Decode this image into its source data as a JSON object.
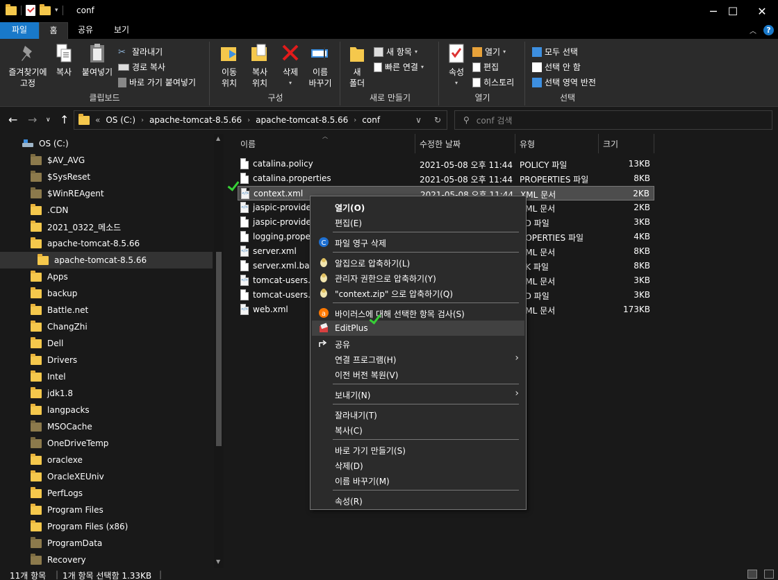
{
  "window": {
    "title": "conf",
    "minimize": "─",
    "maximize": "☐",
    "close": "✕"
  },
  "ribbon_tabs": [
    "파일",
    "홈",
    "공유",
    "보기"
  ],
  "ribbon": {
    "clipboard": {
      "pin": "즐겨찾기에\n고정",
      "copy": "복사",
      "paste": "붙여넣기",
      "cut": "잘라내기",
      "copy_path": "경로 복사",
      "paste_shortcut": "바로 가기 붙여넣기",
      "label": "클립보드"
    },
    "organize": {
      "move": "이동\n위치",
      "copyto": "복사\n위치",
      "delete": "삭제",
      "rename": "이름\n바꾸기",
      "label": "구성"
    },
    "new": {
      "new_folder": "새\n폴더",
      "new_item": "새 항목",
      "easy_access": "빠른 연결",
      "label": "새로 만들기"
    },
    "open": {
      "properties": "속성",
      "open": "열기",
      "edit": "편집",
      "history": "히스토리",
      "label": "열기"
    },
    "select": {
      "select_all": "모두 선택",
      "select_none": "선택 안 함",
      "invert": "선택 영역 반전",
      "label": "선택"
    }
  },
  "address": {
    "overflow": "«",
    "crumbs": [
      "OS (C:)",
      "apache-tomcat-8.5.66",
      "apache-tomcat-8.5.66",
      "conf"
    ],
    "search_placeholder": "conf 검색"
  },
  "nav": {
    "drive": "OS (C:)",
    "items": [
      {
        "name": "$AV_AVG",
        "gray": true
      },
      {
        "name": "$SysReset",
        "gray": true
      },
      {
        "name": "$WinREAgent",
        "gray": true
      },
      {
        "name": ".CDN",
        "gray": false
      },
      {
        "name": "2021_0322_메소드",
        "gray": false
      },
      {
        "name": "apache-tomcat-8.5.66",
        "gray": false
      },
      {
        "name": "apache-tomcat-8.5.66",
        "gray": false,
        "selected": true,
        "indent": true
      },
      {
        "name": "Apps",
        "gray": false
      },
      {
        "name": "backup",
        "gray": false
      },
      {
        "name": "Battle.net",
        "gray": false
      },
      {
        "name": "ChangZhi",
        "gray": false
      },
      {
        "name": "Dell",
        "gray": false
      },
      {
        "name": "Drivers",
        "gray": false
      },
      {
        "name": "Intel",
        "gray": false
      },
      {
        "name": "jdk1.8",
        "gray": false
      },
      {
        "name": "langpacks",
        "gray": false
      },
      {
        "name": "MSOCache",
        "gray": true
      },
      {
        "name": "OneDriveTemp",
        "gray": true
      },
      {
        "name": "oraclexe",
        "gray": false
      },
      {
        "name": "OracleXEUniv",
        "gray": false
      },
      {
        "name": "PerfLogs",
        "gray": false
      },
      {
        "name": "Program Files",
        "gray": false
      },
      {
        "name": "Program Files (x86)",
        "gray": false
      },
      {
        "name": "ProgramData",
        "gray": true
      },
      {
        "name": "Recovery",
        "gray": true
      }
    ]
  },
  "columns": {
    "name": "이름",
    "modified": "수정한 날짜",
    "type": "유형",
    "size": "크기"
  },
  "files": [
    {
      "name": "catalina.policy",
      "date": "2021-05-08 오후 11:44",
      "type": "POLICY 파일",
      "size": "13KB",
      "xml": false
    },
    {
      "name": "catalina.properties",
      "date": "2021-05-08 오후 11:44",
      "type": "PROPERTIES 파일",
      "size": "8KB",
      "xml": false
    },
    {
      "name": "context.xml",
      "date": "2021-05-08 오후 11:44",
      "type": "XML 문서",
      "size": "2KB",
      "xml": true,
      "selected": true
    },
    {
      "name": "jaspic-providers",
      "date": "",
      "type": "XML 문서",
      "size": "2KB",
      "xml": true
    },
    {
      "name": "jaspic-providers",
      "date": "",
      "type": "SD 파일",
      "size": "3KB",
      "xml": false
    },
    {
      "name": "logging.propert",
      "date": "",
      "type": "ROPERTIES 파일",
      "size": "4KB",
      "xml": false
    },
    {
      "name": "server.xml",
      "date": "",
      "type": "XML 문서",
      "size": "8KB",
      "xml": true
    },
    {
      "name": "server.xml.bak",
      "date": "",
      "type": "AK 파일",
      "size": "8KB",
      "xml": false
    },
    {
      "name": "tomcat-users.xr",
      "date": "",
      "type": "XML 문서",
      "size": "3KB",
      "xml": true
    },
    {
      "name": "tomcat-users.xs",
      "date": "",
      "type": "SD 파일",
      "size": "3KB",
      "xml": false
    },
    {
      "name": "web.xml",
      "date": "",
      "type": "XML 문서",
      "size": "173KB",
      "xml": true
    }
  ],
  "context_menu": [
    {
      "label": "열기(O)",
      "bold": true
    },
    {
      "label": "편집(E)"
    },
    {
      "sep": true
    },
    {
      "label": "파일 영구 삭제",
      "icon": "ccleaner-icon"
    },
    {
      "sep": true
    },
    {
      "label": "알집으로 압축하기(L)",
      "icon": "alzip-icon"
    },
    {
      "label": "관리자 권한으로 압축하기(Y)",
      "icon": "alzip-icon"
    },
    {
      "label": "\"context.zip\" 으로 압축하기(Q)",
      "icon": "alzip-icon"
    },
    {
      "sep": true
    },
    {
      "label": "바이러스에 대해 선택한 항목 검사(S)",
      "icon": "avast-icon"
    },
    {
      "label": "EditPlus",
      "icon": "editplus-icon",
      "highlight": true
    },
    {
      "label": "공유",
      "icon": "share-icon"
    },
    {
      "label": "연결 프로그램(H)",
      "submenu": true
    },
    {
      "label": "이전 버전 복원(V)"
    },
    {
      "sep": true
    },
    {
      "label": "보내기(N)",
      "submenu": true
    },
    {
      "sep": true
    },
    {
      "label": "잘라내기(T)"
    },
    {
      "label": "복사(C)"
    },
    {
      "sep": true
    },
    {
      "label": "바로 가기 만들기(S)"
    },
    {
      "label": "삭제(D)"
    },
    {
      "label": "이름 바꾸기(M)"
    },
    {
      "sep": true
    },
    {
      "label": "속성(R)"
    }
  ],
  "status": {
    "count": "11개 항목",
    "selection": "1개 항목 선택함 1.33KB"
  }
}
